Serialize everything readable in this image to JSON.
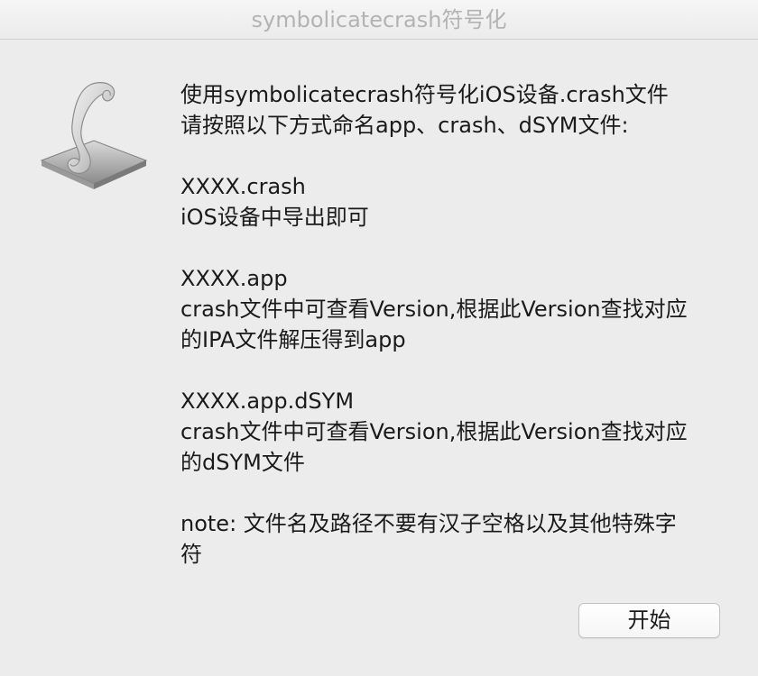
{
  "window": {
    "title": "symbolicatecrash符号化"
  },
  "icon": {
    "name": "script-icon"
  },
  "message": {
    "intro_line1": "使用symbolicatecrash符号化iOS设备.crash文件",
    "intro_line2": "请按照以下方式命名app、crash、dSYM文件:",
    "crash_name": "XXXX.crash",
    "crash_desc": "iOS设备中导出即可",
    "app_name": "XXXX.app",
    "app_desc_line1": "crash文件中可查看Version,根据此Version查找对应",
    "app_desc_line2": "的IPA文件解压得到app",
    "dsym_name": "XXXX.app.dSYM",
    "dsym_desc_line1": "crash文件中可查看Version,根据此Version查找对应",
    "dsym_desc_line2": "的dSYM文件",
    "note_line1": "note: 文件名及路径不要有汉子空格以及其他特殊字",
    "note_line2": "符"
  },
  "buttons": {
    "start_label": "开始"
  }
}
